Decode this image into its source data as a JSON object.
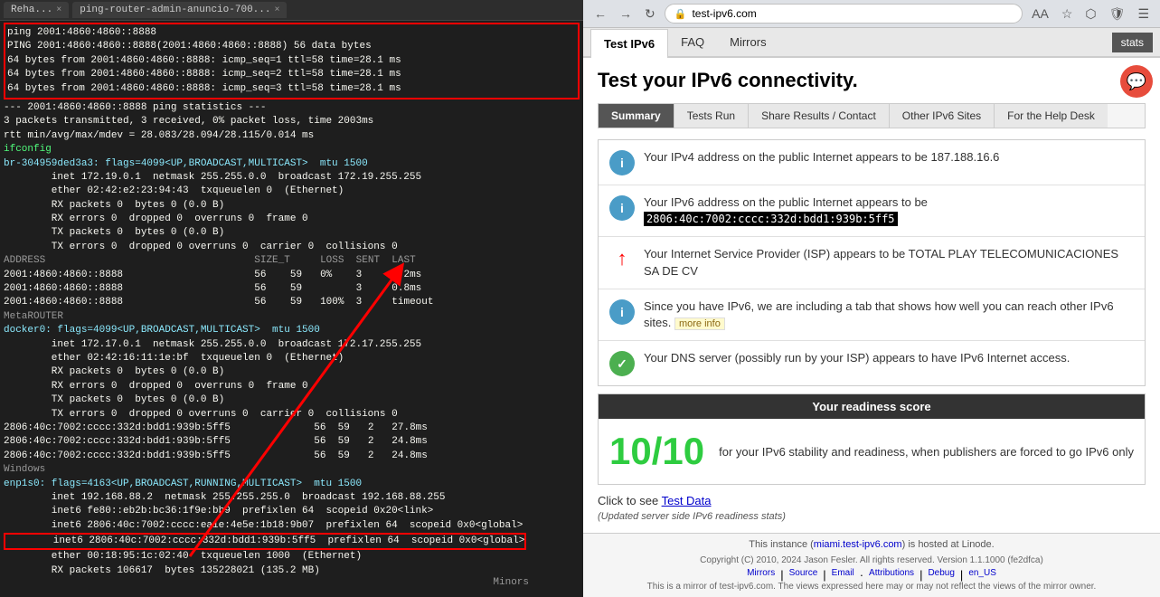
{
  "terminal": {
    "tabs": [
      {
        "label": "ping-router-admin-anuncio-700...",
        "active": false
      },
      {
        "label": "Reha...",
        "active": false
      }
    ],
    "lines_top_red": [
      "ping 2001:4860:4860::8888",
      "PING 2001:4860:4860::8888(2001:4860:4860::8888) 56 data bytes",
      "64 bytes from 2001:4860:4860::8888: icmp_seq=1 ttl=58 time=28.1 ms",
      "64 bytes from 2001:4860:4860::8888: icmp_seq=2 ttl=58 time=28.1 ms",
      "64 bytes from 2001:4860:4860::8888: icmp_seq=3 ttl=58 time=28.1 ms"
    ],
    "stats_line": "--- 2001:4860:4860::8888 ping statistics ---",
    "stats_results": "3 packets transmitted, 3 received, 0% packet loss, time 2003ms",
    "rtt_line": "rtt min/avg/max/mdev = 28.083/28.094/28.115/0.014 ms",
    "ifconfig_cmd": "ifconfig",
    "interface_lines": [
      "br-304959ded3a3: flags=4099<UP,BROADCAST,MULTICAST>  mtu 1500",
      "        inet 172.19.0.1  netmask 255.255.0.0  broadcast 172.19.255.255",
      "        ether 02:42:e2:23:94:43  txqueuelen 0  (Ethernet)",
      "        RX packets 0  bytes 0 (0.0 B)",
      "        RX errors 0  dropped 0  overruns 0  frame 0",
      "        TX packets 0  bytes 0 (0.0 B)",
      "        TX errors 0  dropped 0 overruns 0  carrier 0  collisions 0"
    ],
    "table_header": "ADDRESS                          SIZE_T",
    "table_rows": [
      {
        "addr": "2001:4860:4860::8888",
        "size": "56",
        "t": "59"
      },
      {
        "addr": "2001:4860:4860::8888",
        "size": "56",
        "t": "59"
      },
      {
        "addr": "2001:4860:4860::8888",
        "size": "56",
        "t": "59"
      }
    ],
    "loss_header": "LOSS  SENT  LAST",
    "loss_rows": [
      {
        "loss": "0%",
        "sent": "3",
        "last": "0.2ms"
      },
      {
        "loss": "",
        "sent": "3",
        "last": "0.8ms"
      },
      {
        "loss": "100%",
        "sent": "3",
        "last": "timeout"
      }
    ],
    "more_interfaces": [
      "docker0: flags=4099<UP,BROADCAST,MULTICAST>  mtu 1500",
      "        inet 172.17.0.1  netmask 255.255.0.0  broadcast 172.17.255.255",
      "        ether 02:42:16:11:1e:bf  txqueuelen 0  (Ethernet)",
      "        RX packets 0  bytes 0 (0.0 B)",
      "        RX errors 0  dropped 0  overruns 0  frame 0",
      "        TX packets 0  bytes 0 (0.0 B)",
      "        TX errors 0  dropped 0 overruns 0  carrier 0  collisions 0"
    ],
    "enp_lines": [
      "enp1s0: flags=4163<UP,BROADCAST,RUNNING,MULTICAST>  mtu 1500",
      "        inet 192.168.88.2  netmask 255.255.255.0  broadcast 192.168.88.255",
      "        inet6 fe80::eb2b:bc36:1f9e:bb9  prefixlen 64  scopeid 0x20<link>",
      "        inet6 2806:40c:7002:cccc:ea1e:4e5e:1b18:9b07  prefixlen 64  scopeid 0x0<global>"
    ],
    "highlighted_line": "        inet6 2806:40c:7002:cccc:332d:bdd1:939b:5ff5  prefixlen 64  scopeid 0x0<global>",
    "more_enp": [
      "        ether 00:18:95:1c:02:40  txqueuelen 1000  (Ethernet)",
      "        RX packets 106617  bytes 135228021 (135.2 MB)"
    ],
    "more_loss_rows": [
      {
        "n": "2",
        "val": "27.8ms"
      },
      {
        "n": "2",
        "val": "24.8ms"
      },
      {
        "n": "2",
        "val": "24.8ms"
      }
    ],
    "minors_label": "Minors"
  },
  "browser": {
    "address": "test-ipv6.com",
    "nav_tabs": [
      {
        "label": "Test IPv6",
        "active": true
      },
      {
        "label": "FAQ",
        "active": false
      },
      {
        "label": "Mirrors",
        "active": false
      }
    ],
    "stats_btn": "stats",
    "page_title": "Test your IPv6 connectivity.",
    "content_tabs": [
      {
        "label": "Summary",
        "active": true
      },
      {
        "label": "Tests Run",
        "active": false
      },
      {
        "label": "Share Results / Contact",
        "active": false
      },
      {
        "label": "Other IPv6 Sites",
        "active": false
      },
      {
        "label": "For the Help Desk",
        "active": false
      }
    ],
    "info_rows": [
      {
        "icon": "i",
        "icon_type": "blue",
        "text": "Your IPv4 address on the public Internet appears to be 187.188.16.6"
      },
      {
        "icon": "i",
        "icon_type": "blue",
        "text_before": "Your IPv6 address on the public Internet appears to be",
        "ipv6": "2806:40c:7002:cccc:332d:bdd1:939b:5ff5",
        "text_after": ""
      },
      {
        "icon": "→",
        "icon_type": "red-arrow",
        "text": "Your Internet Service Provider (ISP) appears to be TOTAL PLAY TELECOMUNICACIONES SA DE CV"
      },
      {
        "icon": "i",
        "icon_type": "blue",
        "text_before": "Since you have IPv6, we are including a tab that shows how well you can reach other IPv6 sites.",
        "more_info": "more info",
        "text_after": ""
      },
      {
        "icon": "✓",
        "icon_type": "green-check",
        "text": "Your DNS server (possibly run by your ISP) appears to have IPv6 Internet access."
      }
    ],
    "readiness": {
      "header": "Your readiness score",
      "score": "10/10",
      "description": "for your IPv6 stability and readiness, when publishers are forced to go IPv6 only"
    },
    "test_data_text": "Click to see",
    "test_data_link": "Test Data",
    "updated_text": "(Updated server side IPv6 readiness stats)",
    "footer_hosted": "This instance (miami.test-ipv6.com) is hosted at Linode.",
    "footer_copyright": "Copyright (C) 2010, 2024 Jason Fesler. All rights reserved. Version 1.1.1000 (fe2dfca)",
    "footer_links": [
      "Mirrors",
      "Source",
      "Email",
      "Attributions",
      "Debug",
      "en_US"
    ],
    "footer_mirror_note": "This is a mirror of test-ipv6.com. The views expressed here may or may not reflect the views of the mirror owner."
  }
}
